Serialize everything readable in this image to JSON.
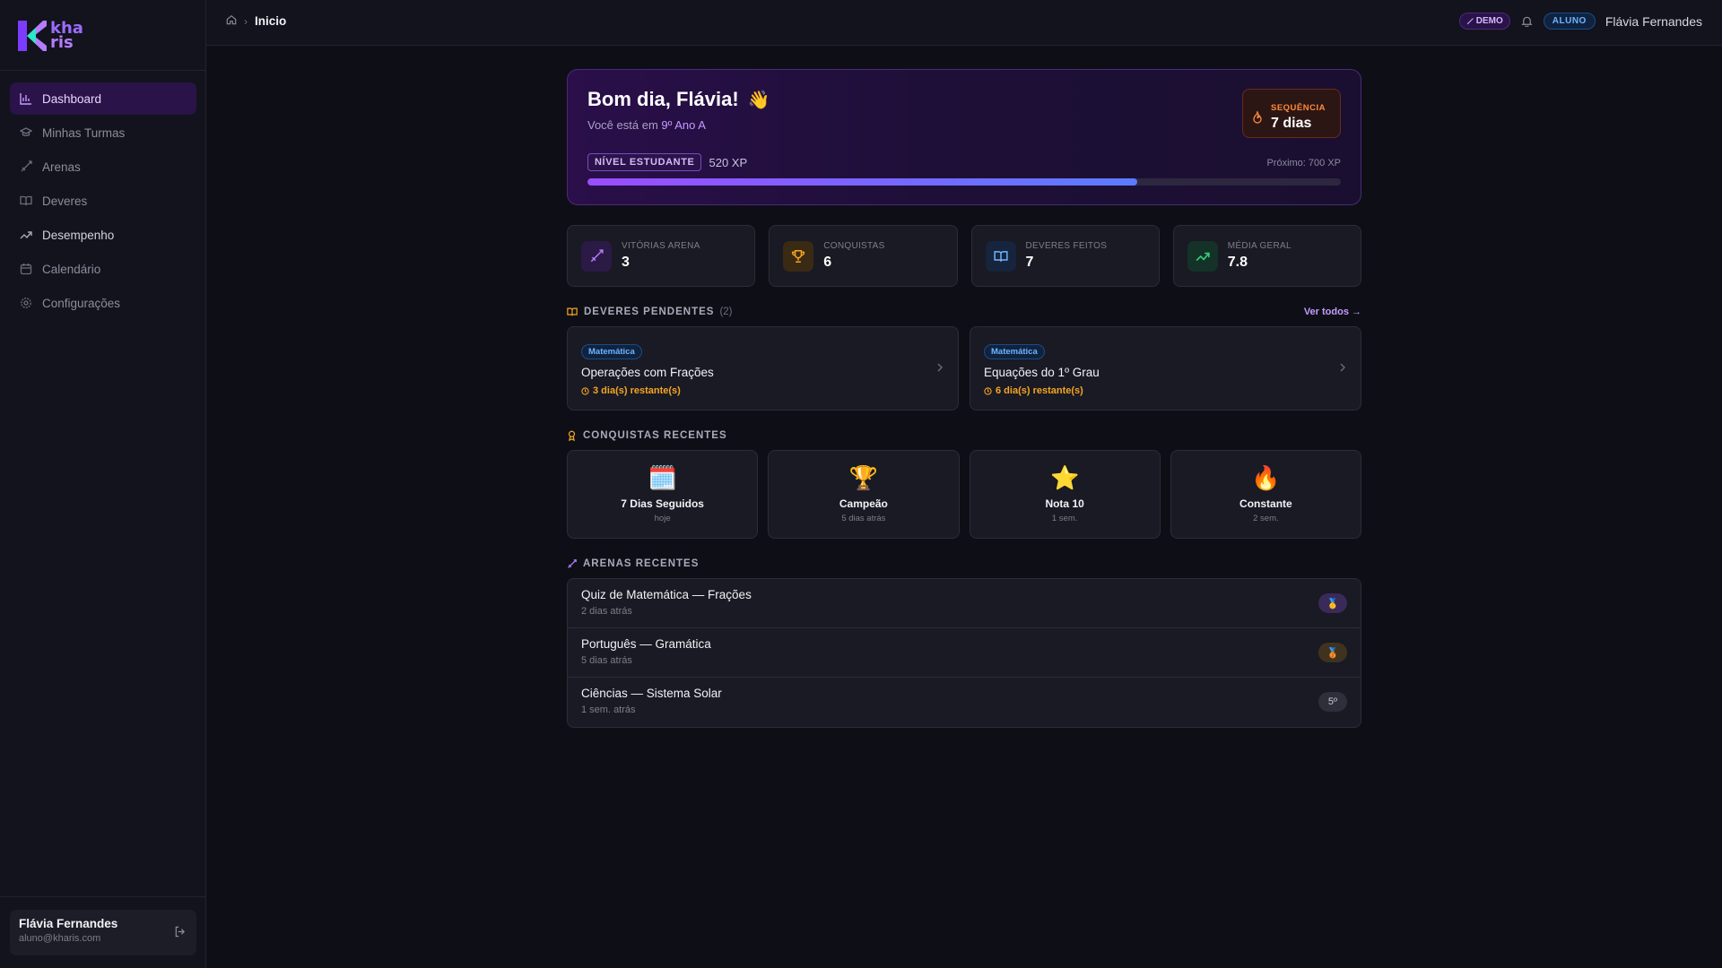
{
  "brand": {
    "logo_line1": "kha",
    "logo_line2": "ris"
  },
  "sidebar": {
    "items": [
      {
        "label": "Dashboard"
      },
      {
        "label": "Minhas Turmas"
      },
      {
        "label": "Arenas"
      },
      {
        "label": "Deveres"
      },
      {
        "label": "Desempenho"
      },
      {
        "label": "Calendário"
      },
      {
        "label": "Configurações"
      }
    ],
    "user": {
      "name": "Flávia Fernandes",
      "email": "aluno@kharis.com"
    }
  },
  "topbar": {
    "breadcrumb_current": "Inicio",
    "demo_label": "DEMO",
    "role_label": "ALUNO",
    "user_name": "Flávia Fernandes"
  },
  "hero": {
    "greeting": "Bom dia, Flávia!",
    "wave": "👋",
    "class_prefix": "Você está em ",
    "class_name": "9º Ano A",
    "streak_label": "SEQUÊNCIA",
    "streak_value": "7 dias",
    "level_label": "NÍVEL ESTUDANTE",
    "xp": "520 XP",
    "next": "Próximo: 700 XP",
    "progress": 0.73
  },
  "stats": [
    {
      "label": "VITÓRIAS ARENA",
      "value": "3"
    },
    {
      "label": "CONQUISTAS",
      "value": "6"
    },
    {
      "label": "DEVERES FEITOS",
      "value": "7"
    },
    {
      "label": "MÉDIA GERAL",
      "value": "7.8"
    }
  ],
  "pending": {
    "title": "DEVERES PENDENTES",
    "count": "(2)",
    "link": "Ver todos →",
    "items": [
      {
        "subject": "Matemática",
        "title": "Operações com Frações",
        "due": "3 dia(s) restante(s)"
      },
      {
        "subject": "Matemática",
        "title": "Equações do 1º Grau",
        "due": "6 dia(s) restante(s)"
      }
    ]
  },
  "achievements": {
    "title": "CONQUISTAS RECENTES",
    "items": [
      {
        "emoji": "🗓️",
        "name": "7 Dias Seguidos",
        "when": "hoje"
      },
      {
        "emoji": "🏆",
        "name": "Campeão",
        "when": "5 dias atrás"
      },
      {
        "emoji": "⭐",
        "name": "Nota 10",
        "when": "1 sem."
      },
      {
        "emoji": "🔥",
        "name": "Constante",
        "when": "2 sem."
      }
    ]
  },
  "arenas": {
    "title": "ARENAS RECENTES",
    "items": [
      {
        "name": "Quiz de Matemática — Frações",
        "when": "2 dias atrás",
        "badge": "🥇"
      },
      {
        "name": "Português — Gramática",
        "when": "5 dias atrás",
        "badge": "🥉"
      },
      {
        "name": "Ciências — Sistema Solar",
        "when": "1 sem. atrás",
        "badge": "5º"
      }
    ]
  },
  "colors": {
    "accent": "#9b4dff",
    "bg": "#0e0f16",
    "warning": "#f5a524",
    "info": "#6fb4ff"
  }
}
